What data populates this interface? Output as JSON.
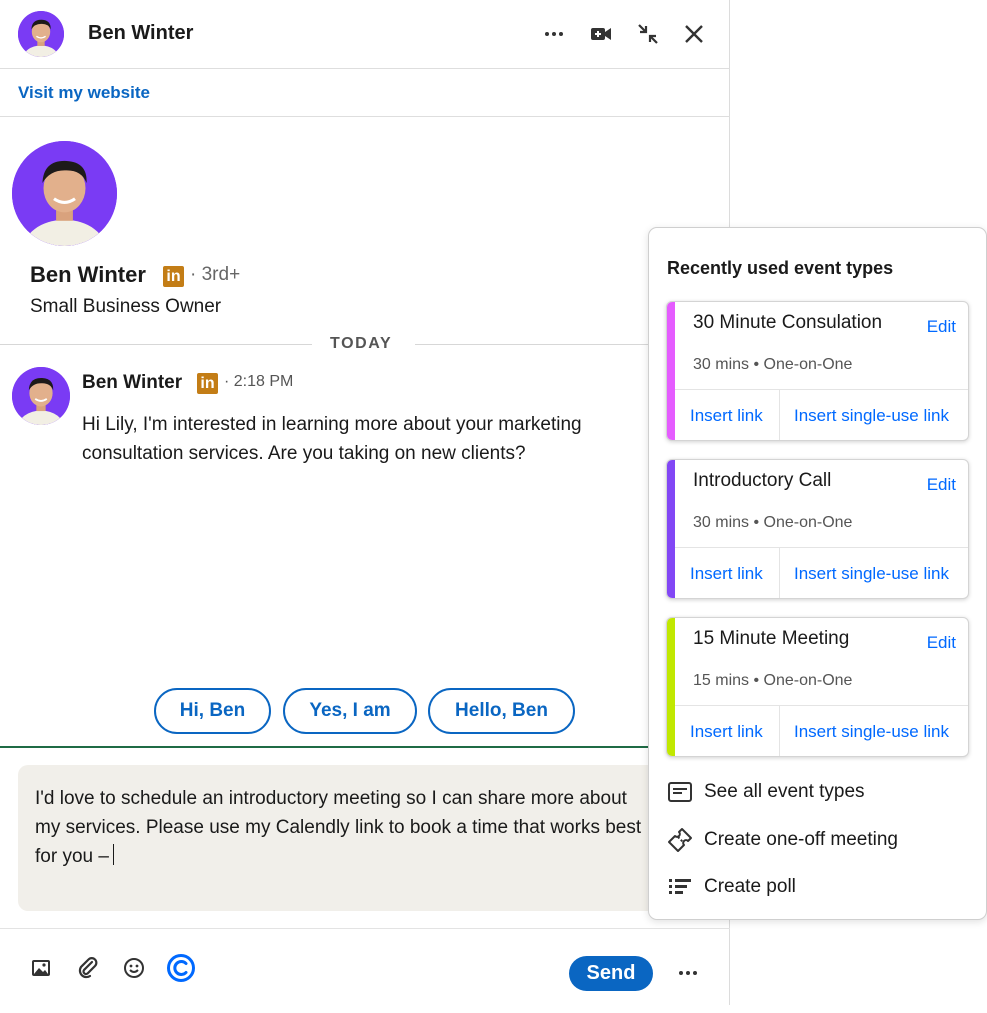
{
  "header": {
    "contact_name": "Ben Winter",
    "icons": [
      "more-horizontal-icon",
      "video-call-icon",
      "minimize-icon",
      "close-icon"
    ]
  },
  "website_link": "Visit my website",
  "profile": {
    "name": "Ben Winter",
    "network_badge": "in",
    "degree": "· 3rd+",
    "headline": "Small Business Owner"
  },
  "divider_label": "TODAY",
  "message": {
    "sender": "Ben Winter",
    "badge": "in",
    "time": "· 2:18 PM",
    "text": "Hi Lily, I'm interested in learning more about your marketing consultation services. Are you taking on new clients?"
  },
  "quick_replies": [
    "Hi, Ben",
    "Yes, I am",
    "Hello, Ben"
  ],
  "composer": {
    "text": "I'd love to schedule an introductory meeting so I can share more about my services. Please use my Calendly link to book a time that works best for you –"
  },
  "toolbar": {
    "send_label": "Send",
    "icons": [
      "image-icon",
      "attachment-icon",
      "emoji-icon",
      "calendly-icon",
      "more-horizontal-icon"
    ]
  },
  "panel": {
    "title": "Recently used event types",
    "event_types": [
      {
        "title": "30 Minute Consulation",
        "meta": "30 mins • One-on-One",
        "edit_label": "Edit",
        "insert_label": "Insert link",
        "single_use_label": "Insert single-use link",
        "color": "#e55cff"
      },
      {
        "title": "Introductory Call",
        "meta": "30 mins • One-on-One",
        "edit_label": "Edit",
        "insert_label": "Insert link",
        "single_use_label": "Insert single-use link",
        "color": "#8247f5"
      },
      {
        "title": "15 Minute Meeting",
        "meta": "15 mins • One-on-One",
        "edit_label": "Edit",
        "insert_label": "Insert link",
        "single_use_label": "Insert single-use link",
        "color": "#c1e800"
      }
    ],
    "menu": [
      {
        "label": "See all event types",
        "icon": "list-icon"
      },
      {
        "label": "Create one-off meeting",
        "icon": "ticket-icon"
      },
      {
        "label": "Create poll",
        "icon": "poll-icon"
      }
    ]
  },
  "colors": {
    "linkedin_blue": "#0a66c2",
    "calendly_blue": "#0069ff",
    "avatar_purple": "#7a3bf4",
    "linkedin_badge": "#c37d16",
    "composer_bg": "#f1efea",
    "composer_focus": "#1f6b45"
  }
}
